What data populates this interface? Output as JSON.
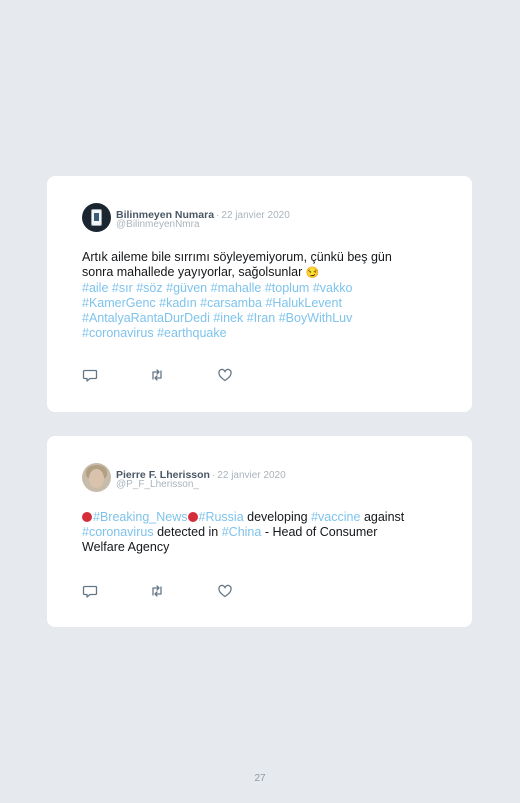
{
  "tweets": [
    {
      "name": "Bilinmeyen Numara",
      "date": "22 janvier 2020",
      "handle": "@BilinmeyenNmra",
      "text_line1": "Artık aileme bile sırrımı söyleyemiyorum, çünkü beş gün",
      "text_line2": "sonra mahallede yayıyorlar, sağolsunlar",
      "emoji": "😏",
      "hashtags_line1": [
        "#aile",
        "#sır",
        "#söz",
        "#güven",
        "#mahalle",
        "#toplum",
        "#vakko"
      ],
      "hashtags_line2": [
        "#KamerGenc",
        "#kadın",
        "#carsamba",
        "#HalukLevent"
      ],
      "hashtags_line3": [
        "#AntalyaRantaDurDedi",
        "#inek",
        "#Iran",
        "#BoyWithLuv"
      ],
      "hashtags_line4": [
        "#coronavirus",
        "#earthquake"
      ]
    },
    {
      "name": "Pierre F. Lherisson",
      "date": "22 janvier 2020",
      "handle": "@P_F_Lherisson_",
      "tag_breaking": "#Breaking_News",
      "tag_russia": "#Russia",
      "text_developing": "developing",
      "tag_vaccine": "#vaccine",
      "text_against": "against",
      "tag_coronavirus": "#coronavirus",
      "text_detected": "detected in",
      "tag_china": "#China",
      "text_rest": "- Head of Consumer",
      "text_line3": "Welfare Agency"
    }
  ],
  "separator": "·",
  "icons": {
    "reply": "reply-icon",
    "retweet": "retweet-icon",
    "like": "heart-icon"
  },
  "colors": {
    "hashtag": "#7ec3ec",
    "background": "#e6eaee",
    "card": "#ffffff"
  },
  "page_number": "27"
}
